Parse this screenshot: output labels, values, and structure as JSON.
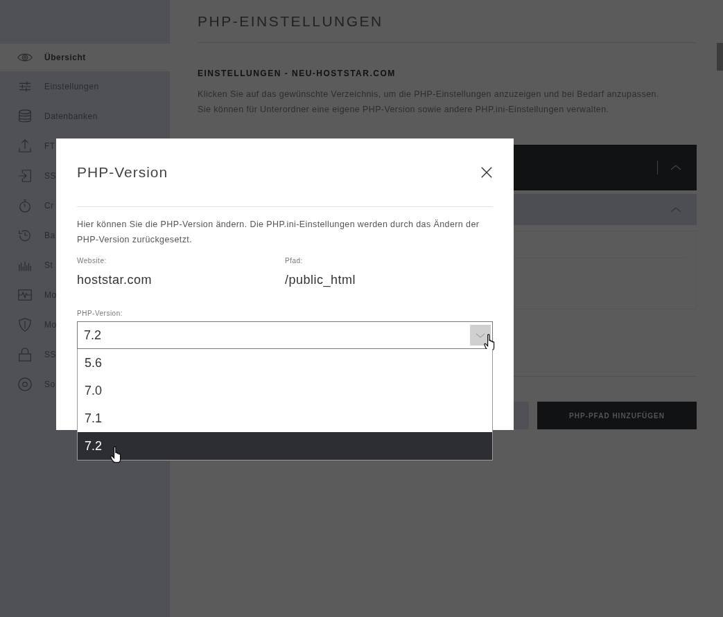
{
  "sidebar": {
    "items": [
      {
        "label": "Übersicht",
        "selected": true
      },
      {
        "label": "Einstellungen",
        "selected": false
      },
      {
        "label": "Datenbanken",
        "selected": false
      },
      {
        "label": "FT",
        "selected": false
      },
      {
        "label": "SS",
        "selected": false
      },
      {
        "label": "Cr",
        "selected": false
      },
      {
        "label": "Ba",
        "selected": false
      },
      {
        "label": "St",
        "selected": false
      },
      {
        "label": "Mo",
        "selected": false
      },
      {
        "label": "Mo",
        "selected": false
      },
      {
        "label": "SS",
        "selected": false
      },
      {
        "label": "So",
        "selected": false
      }
    ]
  },
  "main": {
    "title": "PHP-EINSTELLUNGEN",
    "heading": "EINSTELLUNGEN - NEU-HOSTSTAR.COM",
    "description": "Klicken Sie auf das gewünschte Verzeichnis, um die PHP-Einstellungen anzuzeigen und bei Bedarf anzupassen. Sie können für Unterordner eine eigene PHP-Version sowie andere PHP.ini-Einstellungen verwalten.",
    "add_button": "PHP-PFAD HINZUFÜGEN"
  },
  "modal": {
    "title": "PHP-Version",
    "description": "Hier können Sie die PHP-Version ändern. Die PHP.ini-Einstellungen werden durch das Ändern der PHP-Version zurückgesetzt.",
    "website_label": "Website:",
    "website": "hoststar.com",
    "path_label": "Pfad:",
    "path": "/public_html",
    "version_label": "PHP-Version:",
    "version_value": "7.2",
    "expanded": true,
    "options": [
      {
        "label": "5.6",
        "selected": false
      },
      {
        "label": "7.0",
        "selected": false
      },
      {
        "label": "7.1",
        "selected": false
      },
      {
        "label": "7.2",
        "selected": true
      }
    ]
  }
}
